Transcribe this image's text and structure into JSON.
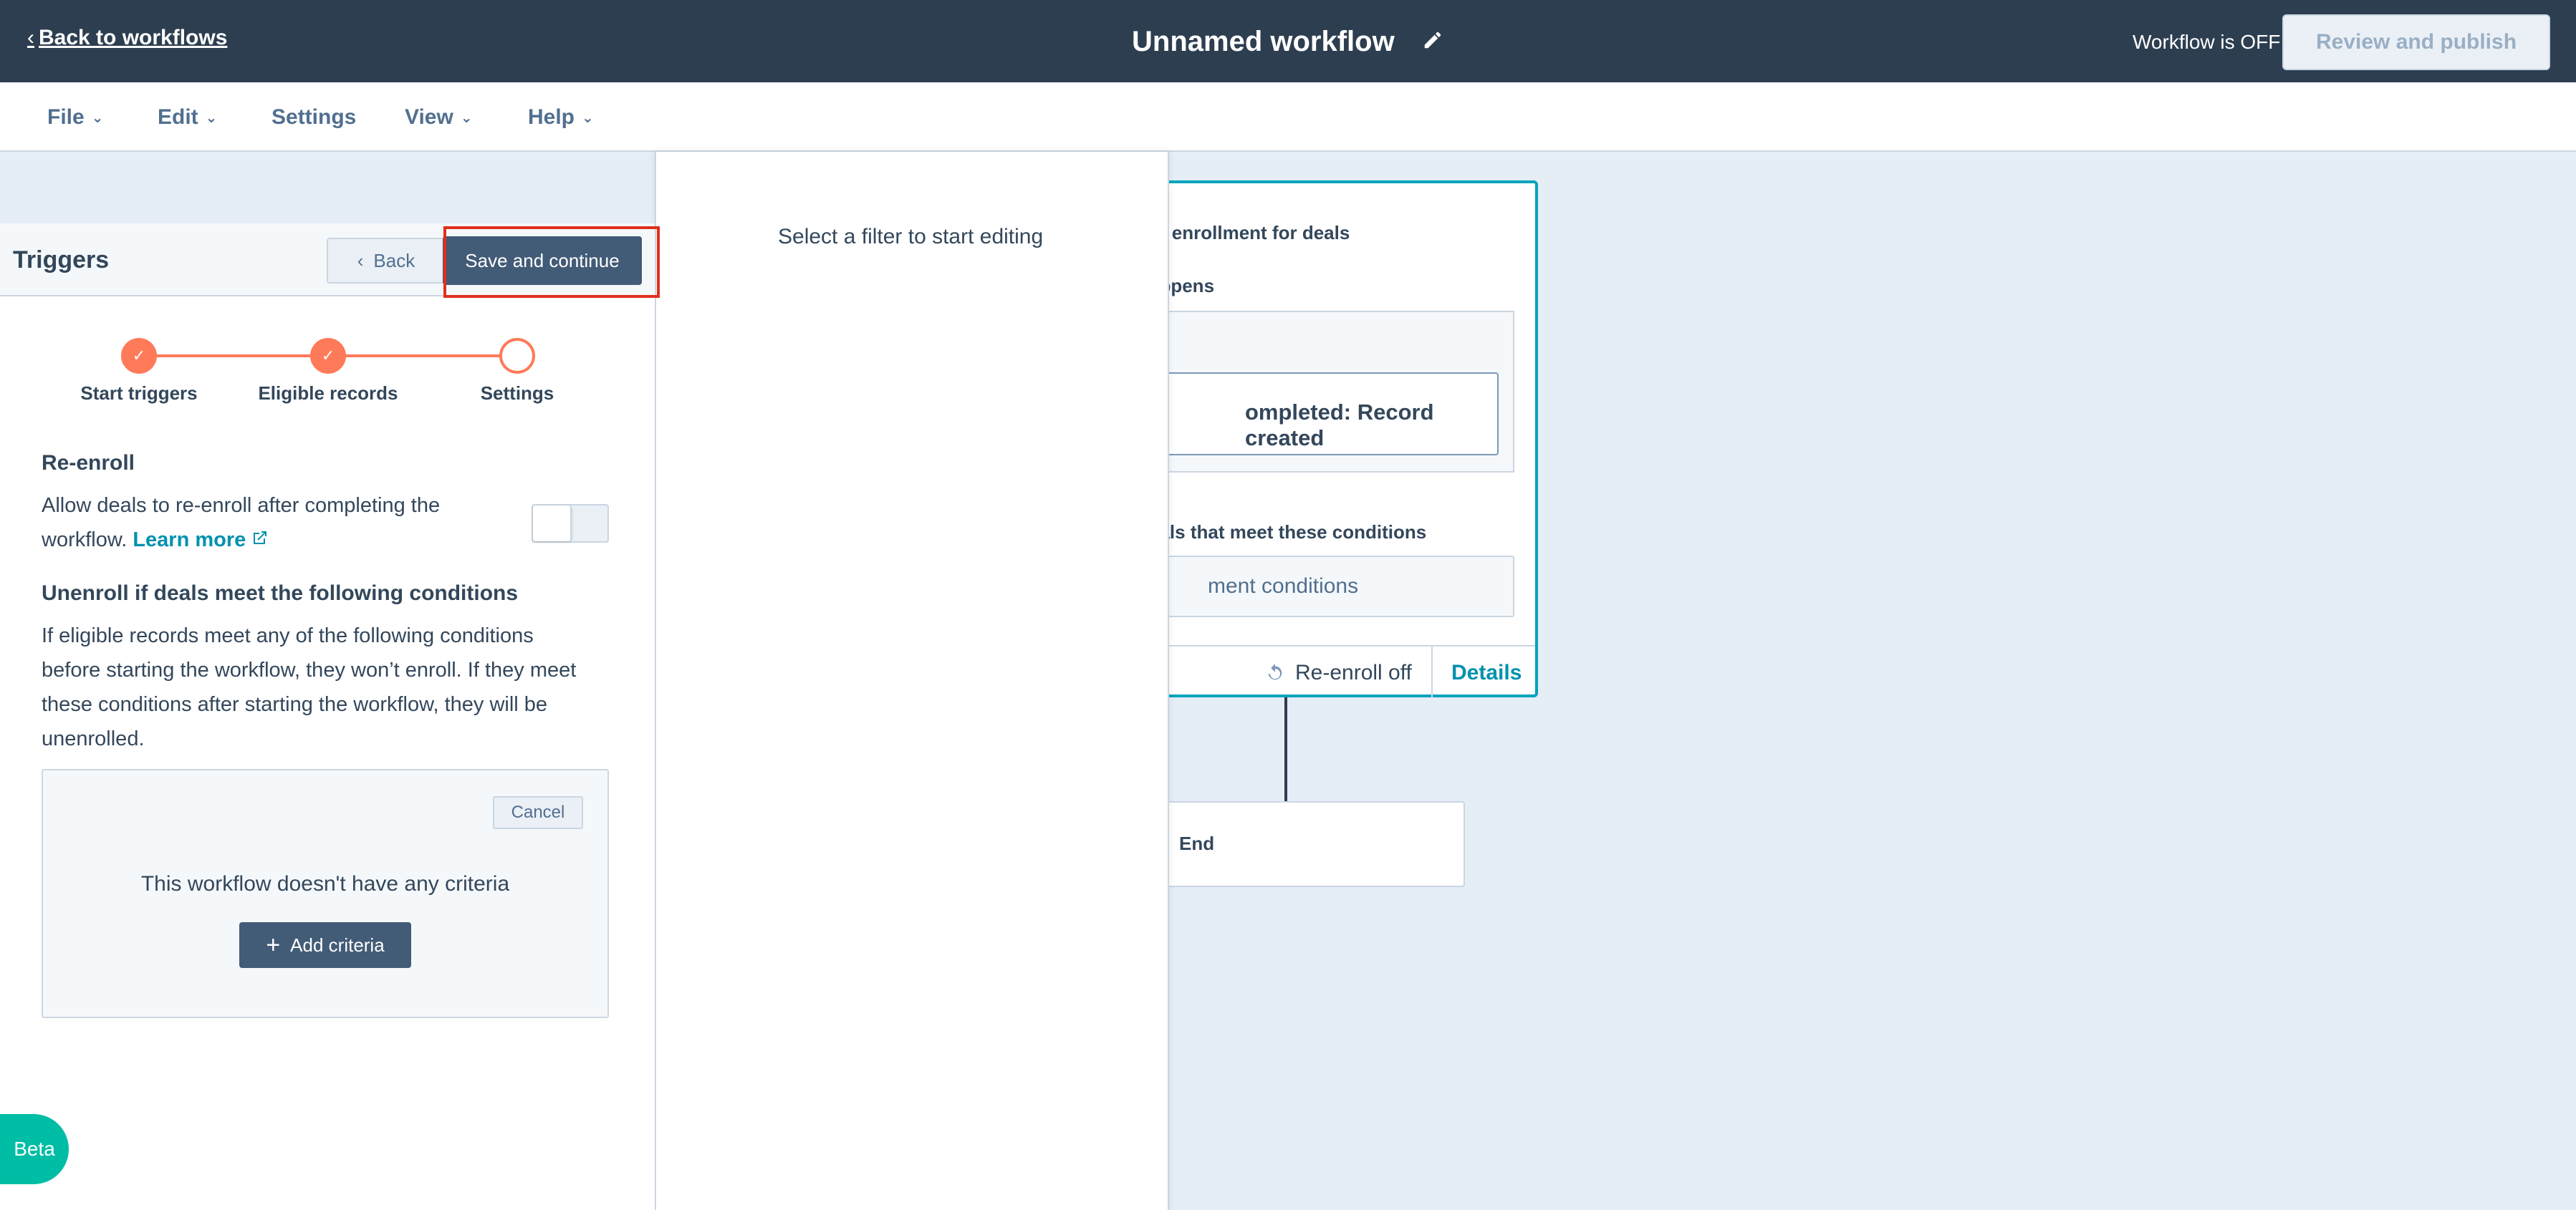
{
  "topbar": {
    "back_label": "Back to workflows",
    "title": "Unnamed workflow",
    "status": "Workflow is OFF",
    "publish_label": "Review and publish"
  },
  "menu": {
    "items": [
      {
        "label": "File",
        "has_caret": true
      },
      {
        "label": "Edit",
        "has_caret": true
      },
      {
        "label": "Settings",
        "has_caret": false
      },
      {
        "label": "View",
        "has_caret": true
      },
      {
        "label": "Help",
        "has_caret": true
      }
    ]
  },
  "triggers_panel": {
    "title": "Triggers",
    "back_label": "Back",
    "save_label": "Save and continue",
    "steps": [
      {
        "label": "Start triggers",
        "state": "done"
      },
      {
        "label": "Eligible records",
        "state": "done"
      },
      {
        "label": "Settings",
        "state": "current"
      }
    ],
    "reenroll_heading": "Re-enroll",
    "reenroll_text": "Allow deals to re-enroll after completing the",
    "reenroll_text2": "workflow.",
    "learn_more": "Learn more",
    "reenroll_enabled": false,
    "unenroll_heading": "Unenroll if deals meet the following conditions",
    "unenroll_lines": [
      "If eligible records meet any of the following conditions",
      "before starting the workflow, they won’t enroll. If they meet",
      "these conditions after starting the workflow, they will be",
      "unenrolled."
    ],
    "cancel_label": "Cancel",
    "empty_message": "This workflow doesn't have any criteria",
    "add_criteria_label": "Add criteria"
  },
  "filter_panel": {
    "message": "Select a filter to start editing"
  },
  "canvas": {
    "trigger_card": {
      "line1": "er enrollment for deals",
      "line2": "appens",
      "event": "ompleted: Record created",
      "line3": "eals that meet these conditions",
      "conditions": "ment conditions",
      "reenroll_status": "Re-enroll off",
      "details_label": "Details"
    },
    "end_label": "End"
  },
  "beta_label": "Beta",
  "colors": {
    "topbar": "#2d3e50",
    "accent": "#ff7a59",
    "link": "#0091ae",
    "primary_button": "#425b76",
    "highlight": "#e0301e",
    "beta": "#00bda5"
  }
}
